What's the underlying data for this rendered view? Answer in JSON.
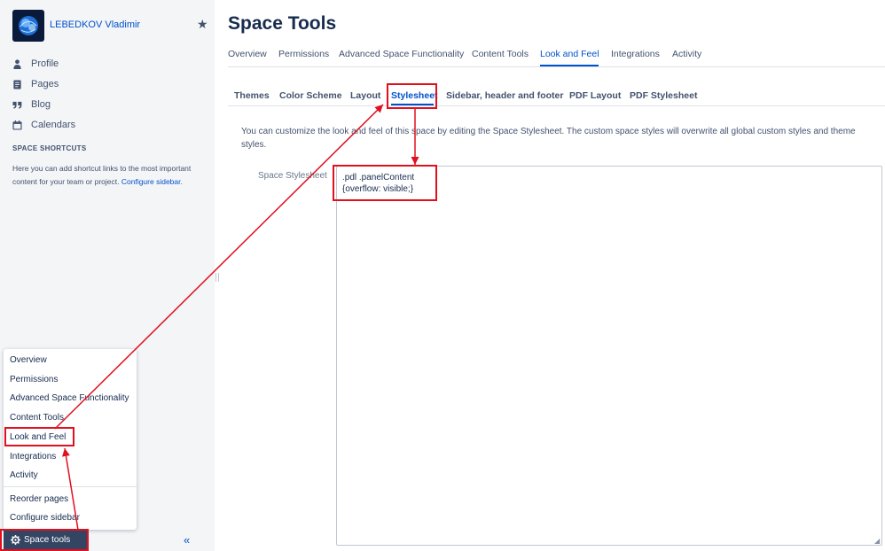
{
  "sidebar": {
    "space_name": "LEBEDKOV Vladimir",
    "nav": [
      {
        "label": "Profile",
        "icon": "person-icon"
      },
      {
        "label": "Pages",
        "icon": "page-icon"
      },
      {
        "label": "Blog",
        "icon": "quote-icon"
      },
      {
        "label": "Calendars",
        "icon": "calendar-icon"
      }
    ],
    "shortcuts_title": "SPACE SHORTCUTS",
    "shortcuts_desc": "Here you can add shortcut links to the most important content for your team or project.",
    "shortcuts_link": "Configure sidebar.",
    "menu": {
      "items": [
        "Overview",
        "Permissions",
        "Advanced Space Functionality",
        "Content Tools",
        "Look and Feel",
        "Integrations",
        "Activity"
      ],
      "secondary": [
        "Reorder pages",
        "Configure sidebar"
      ]
    },
    "space_tools": "Space tools",
    "collapse": "«"
  },
  "main": {
    "title": "Space Tools",
    "tabs": [
      "Overview",
      "Permissions",
      "Advanced Space Functionality",
      "Content Tools",
      "Look and Feel",
      "Integrations",
      "Activity"
    ],
    "active_tab": "Look and Feel",
    "subtabs": [
      "Themes",
      "Color Scheme",
      "Layout",
      "Stylesheet",
      "Sidebar, header and footer",
      "PDF Layout",
      "PDF Stylesheet"
    ],
    "active_subtab": "Stylesheet",
    "description": "You can customize the look and feel of this space by editing the Space Stylesheet. The custom space styles will overwrite all global custom styles and theme styles.",
    "field_label": "Space Stylesheet",
    "stylesheet_value": ".pdl .panelContent\n{overflow: visible;}"
  },
  "colors": {
    "accent": "#0052CC",
    "highlight": "#E0101E",
    "sidebar_bg": "#F4F5F7",
    "space_tools_bg": "#344563"
  }
}
